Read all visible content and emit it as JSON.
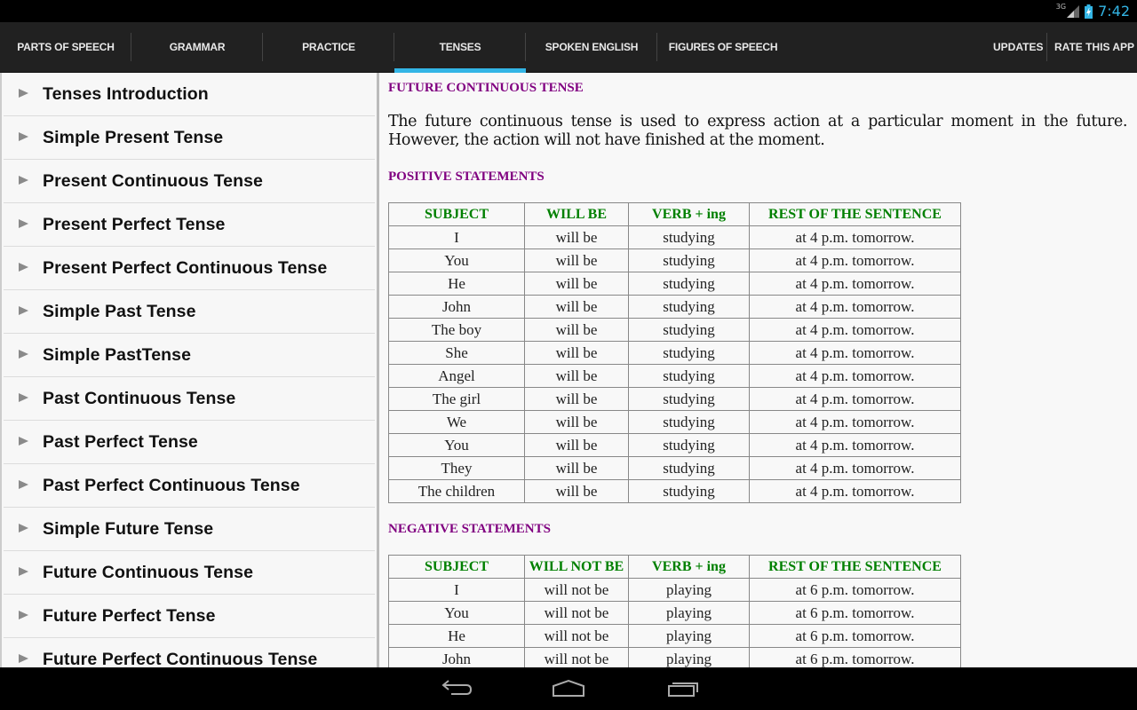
{
  "status_bar": {
    "network": "3G",
    "time": "7:42",
    "accent_color": "#33b5e5"
  },
  "tabs": [
    {
      "label": "PARTS OF SPEECH",
      "active": false
    },
    {
      "label": "GRAMMAR",
      "active": false
    },
    {
      "label": "PRACTICE",
      "active": false
    },
    {
      "label": "TENSES",
      "active": true
    },
    {
      "label": "SPOKEN ENGLISH",
      "active": false
    },
    {
      "label": "FIGURES OF SPEECH",
      "active": false
    }
  ],
  "actions": {
    "updates": "UPDATES",
    "rate": "RATE THIS APP"
  },
  "sidebar": {
    "items": [
      {
        "label": "Tenses Introduction"
      },
      {
        "label": "Simple Present Tense"
      },
      {
        "label": "Present Continuous Tense"
      },
      {
        "label": "Present Perfect Tense"
      },
      {
        "label": "Present Perfect Continuous Tense"
      },
      {
        "label": "Simple Past Tense"
      },
      {
        "label": "Simple PastTense"
      },
      {
        "label": "Past Continuous Tense"
      },
      {
        "label": "Past Perfect Tense"
      },
      {
        "label": "Past Perfect Continuous Tense"
      },
      {
        "label": "Simple Future Tense"
      },
      {
        "label": "Future Continuous Tense"
      },
      {
        "label": "Future Perfect Tense"
      },
      {
        "label": "Future Perfect Continuous Tense"
      }
    ]
  },
  "article": {
    "title": "FUTURE CONTINUOUS TENSE",
    "intro": "The future continuous tense is used to express action at a particular moment in the future. However, the action will not have finished at the moment.",
    "heading_color": "#800080",
    "table_header_color": "#008000",
    "positive": {
      "heading": "POSITIVE STATEMENTS",
      "headers": [
        "SUBJECT",
        "WILL BE",
        "VERB  + ing",
        "REST OF THE SENTENCE"
      ],
      "rows": [
        [
          "I",
          "will be",
          "studying",
          "at 4 p.m. tomorrow."
        ],
        [
          "You",
          "will be",
          "studying",
          "at 4 p.m. tomorrow."
        ],
        [
          "He",
          "will be",
          "studying",
          "at 4 p.m. tomorrow."
        ],
        [
          "John",
          "will be",
          "studying",
          "at 4 p.m. tomorrow."
        ],
        [
          "The boy",
          "will be",
          "studying",
          "at 4 p.m. tomorrow."
        ],
        [
          "She",
          "will be",
          "studying",
          "at 4 p.m. tomorrow."
        ],
        [
          "Angel",
          "will be",
          "studying",
          "at 4 p.m. tomorrow."
        ],
        [
          "The girl",
          "will be",
          "studying",
          "at 4 p.m. tomorrow."
        ],
        [
          "We",
          "will be",
          "studying",
          "at 4 p.m. tomorrow."
        ],
        [
          "You",
          "will be",
          "studying",
          "at 4 p.m. tomorrow."
        ],
        [
          "They",
          "will be",
          "studying",
          "at 4 p.m. tomorrow."
        ],
        [
          "The children",
          "will be",
          "studying",
          "at 4 p.m. tomorrow."
        ]
      ]
    },
    "negative": {
      "heading": "NEGATIVE STATEMENTS",
      "headers": [
        "SUBJECT",
        "WILL NOT BE",
        "VERB + ing",
        "REST OF THE SENTENCE"
      ],
      "rows": [
        [
          "I",
          "will not be",
          "playing",
          "at 6 p.m. tomorrow."
        ],
        [
          "You",
          "will not be",
          "playing",
          "at 6 p.m. tomorrow."
        ],
        [
          "He",
          "will not be",
          "playing",
          "at 6 p.m. tomorrow."
        ],
        [
          "John",
          "will not be",
          "playing",
          "at 6 p.m. tomorrow."
        ]
      ]
    }
  },
  "nav_bar": {
    "icons": [
      "back-icon",
      "home-icon",
      "recents-icon"
    ]
  }
}
